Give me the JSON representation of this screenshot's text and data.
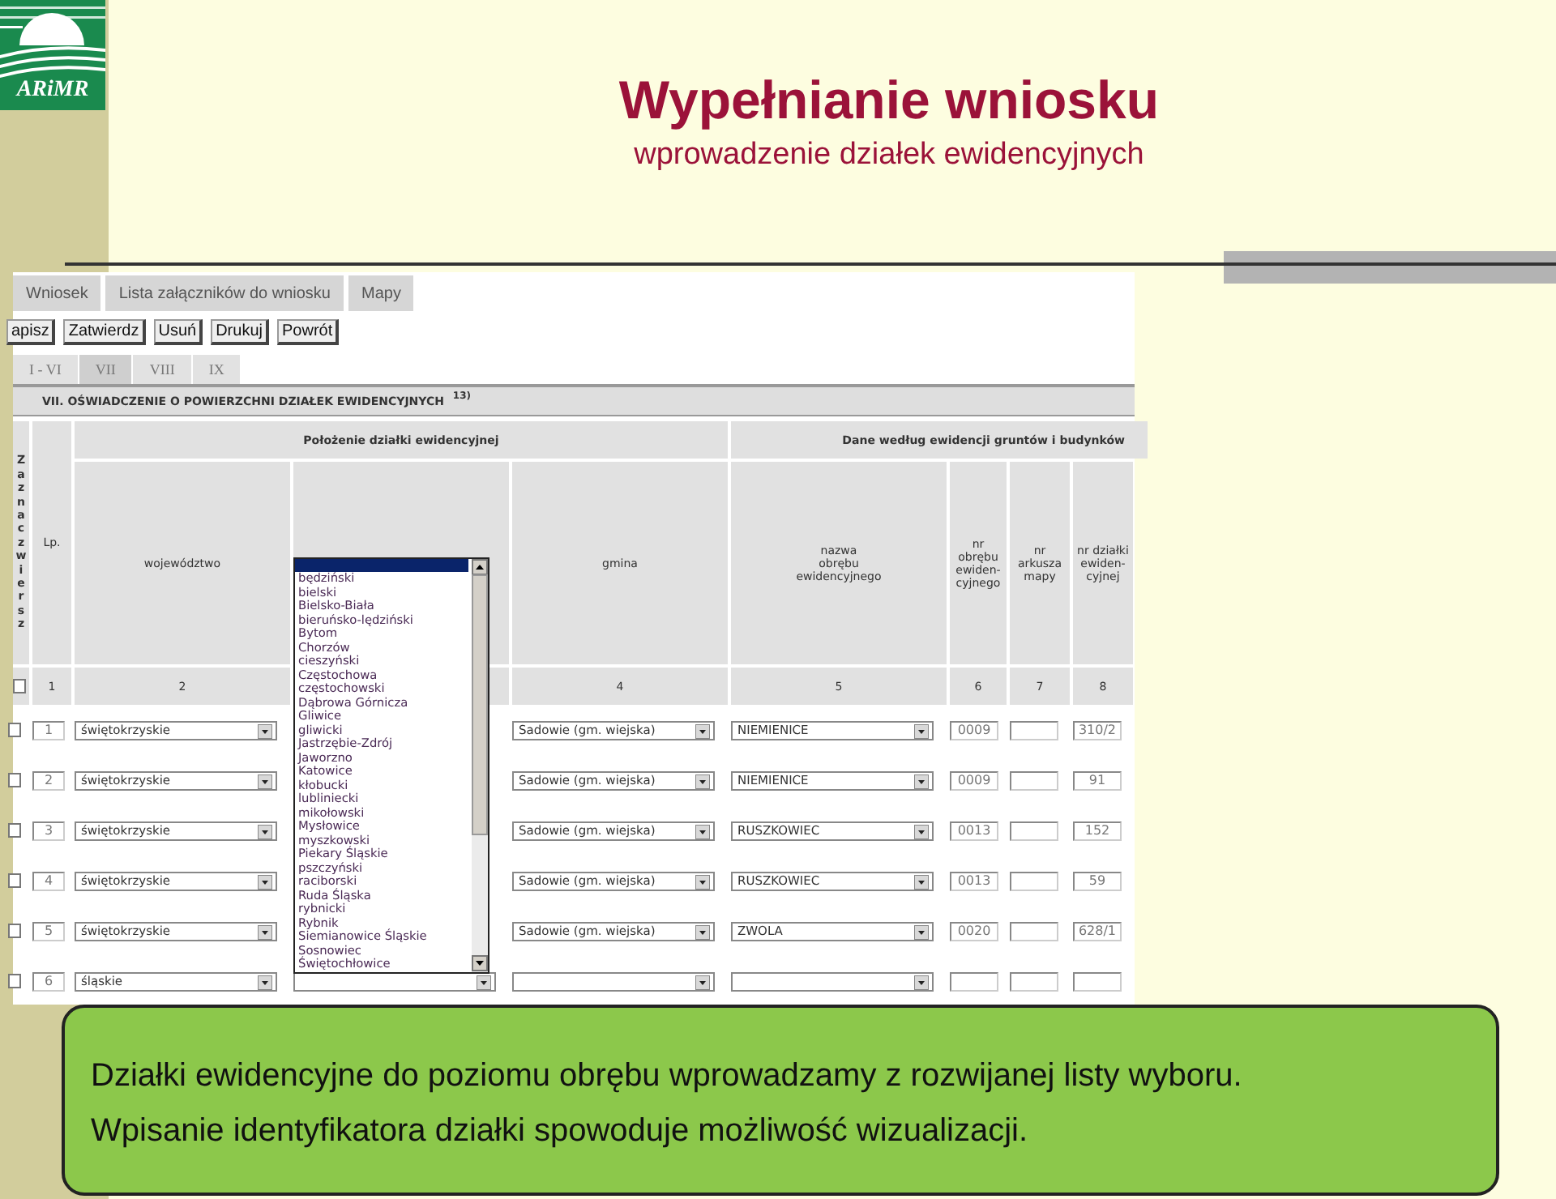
{
  "logo": {
    "text": "ARiMR"
  },
  "title": "Wypełnianie wniosku",
  "subtitle": "wprowadzenie działek ewidencyjnych",
  "screenshot": {
    "tabs": [
      {
        "label": "Wniosek",
        "selected": false
      },
      {
        "label": "Lista załączników do wniosku",
        "selected": false
      },
      {
        "label": "Mapy",
        "selected": false
      }
    ],
    "buttons": [
      "apisz",
      "Zatwierdz",
      "Usuń",
      "Drukuj",
      "Powrót"
    ],
    "section_tabs": [
      {
        "label": "I - VI",
        "selected": false
      },
      {
        "label": "VII",
        "selected": true
      },
      {
        "label": "VIII",
        "selected": false
      },
      {
        "label": "IX",
        "selected": false
      }
    ],
    "section_title": "VII. OŚWIADCZENIE O POWIERZCHNI DZIAŁEK EWIDENCYJNYCH $^{13)}$",
    "group_headers": [
      "Położenie działki ewidencyjnej",
      "Dane według ewidencji gruntów i budynków"
    ],
    "columns": [
      {
        "kind": "vertical",
        "label": "Zaznacz wiersz",
        "checked": false
      },
      {
        "kind": "text",
        "label": "Lp.",
        "number": "1"
      },
      {
        "kind": "text",
        "label": "województwo",
        "number": "2"
      },
      {
        "kind": "covered"
      },
      {
        "kind": "text",
        "label": "gmina",
        "number": "4"
      },
      {
        "kind": "text",
        "label": "nazwa\nobrębu\newidencyjnego",
        "number": "5"
      },
      {
        "kind": "text",
        "label": "nr\nobrębu\newiden-\ncyjnego",
        "number": "6"
      },
      {
        "kind": "text",
        "label": "nr\narkusza\nmapy",
        "number": "7"
      },
      {
        "kind": "text",
        "label": "nr działki\newiden-\ncyjnej",
        "number": "8"
      }
    ],
    "rows": [
      {
        "checked": false,
        "lp": "1",
        "wojewodztwo": "świętokrzyskie",
        "gmina": "Sadowie (gm. wiejska)",
        "obreb": "NIEMIENICE",
        "nr_obrebu": "0009",
        "nr_dzialki": "310/2"
      },
      {
        "checked": false,
        "lp": "2",
        "wojewodztwo": "świętokrzyskie",
        "gmina": "Sadowie (gm. wiejska)",
        "obreb": "NIEMIENICE",
        "nr_obrebu": "0009",
        "nr_dzialki": "91"
      },
      {
        "checked": false,
        "lp": "3",
        "wojewodztwo": "świętokrzyskie",
        "gmina": "Sadowie (gm. wiejska)",
        "obreb": "RUSZKOWIEC",
        "nr_obrebu": "0013",
        "nr_dzialki": "152"
      },
      {
        "checked": false,
        "lp": "4",
        "wojewodztwo": "świętokrzyskie",
        "gmina": "Sadowie (gm. wiejska)",
        "obreb": "RUSZKOWIEC",
        "nr_obrebu": "0013",
        "nr_dzialki": "59"
      },
      {
        "checked": false,
        "lp": "5",
        "wojewodztwo": "świętokrzyskie",
        "gmina": "Sadowie (gm. wiejska)",
        "obreb": "ZWOLA",
        "nr_obrebu": "0020",
        "nr_dzialki": "628/1"
      },
      {
        "checked": false,
        "lp": "6",
        "wojewodztwo": "śląskie",
        "dropdown_open": true
      }
    ],
    "dropdown": {
      "blank_selected": true,
      "options": [
        "będziński",
        "bielski",
        "Bielsko-Biała",
        "bieruńsko-lędziński",
        "Bytom",
        "Chorzów",
        "cieszyński",
        "Częstochowa",
        "częstochowski",
        "Dąbrowa Górnicza",
        "Gliwice",
        "gliwicki",
        "Jastrzębie-Zdrój",
        "Jaworzno",
        "Katowice",
        "kłobucki",
        "lubliniecki",
        "mikołowski",
        "Mysłowice",
        "myszkowski",
        "Piekary Śląskie",
        "pszczyński",
        "raciborski",
        "Ruda Śląska",
        "rybnicki",
        "Rybnik",
        "Siemianowice Śląskie",
        "Sosnowiec",
        "Świętochłowice"
      ]
    }
  },
  "callout": [
    "Działki ewidencyjne do poziomu obrębu wprowadzamy z rozwijanej listy wyboru.",
    "Wpisanie identyfikatora działki spowoduje możliwość wizualizacji."
  ]
}
